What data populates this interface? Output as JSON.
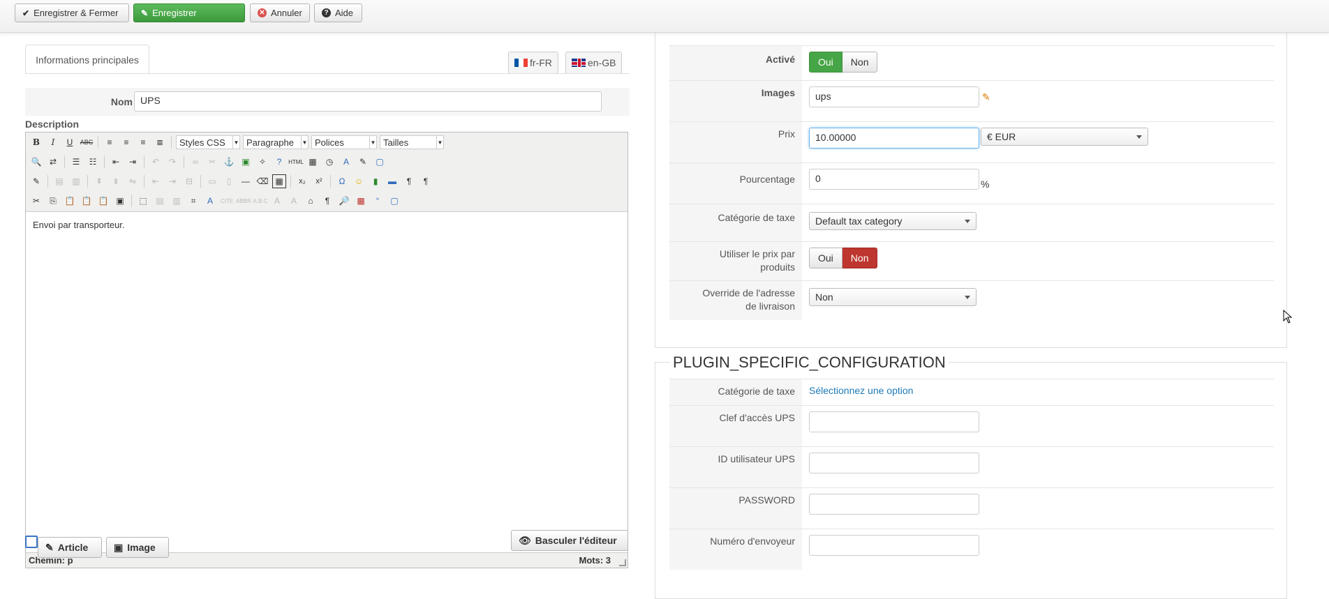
{
  "toolbar": {
    "save_close": "Enregistrer & Fermer",
    "save": "Enregistrer",
    "cancel": "Annuler",
    "help": "Aide"
  },
  "left": {
    "tab_main": "Informations principales",
    "lang_fr": "fr-FR",
    "lang_en": "en-GB",
    "nom_label": "Nom",
    "nom_value": "UPS",
    "description_label": "Description",
    "editor": {
      "styles": "Styles CSS",
      "paragraph": "Paragraphe",
      "fonts": "Polices",
      "sizes": "Tailles",
      "content": "Envoi par transporteur.",
      "path": "Chemin: p",
      "words": "Mots: 3"
    },
    "article_button": "Article",
    "image_button": "Image",
    "toggle_editor": "Basculer l'éditeur"
  },
  "right": {
    "active_label": "Activé",
    "active_yes": "Oui",
    "active_no": "Non",
    "images_label": "Images",
    "images_value": "ups",
    "price_label": "Prix",
    "price_value": "10.00000",
    "currency": "€ EUR",
    "percent_label": "Pourcentage",
    "percent_value": "0",
    "percent_sign": "%",
    "tax_cat_label": "Catégorie de taxe",
    "tax_cat_value": "Default tax category",
    "per_product_label_1": "Utiliser le prix par",
    "per_product_label_2": "produits",
    "per_product_yes": "Oui",
    "per_product_no": "Non",
    "override_label_1": "Override de l'adresse",
    "override_label_2": "de livraison",
    "override_value": "Non",
    "plugin_legend": "PLUGIN_SPECIFIC_CONFIGURATION",
    "plugin_tax_label": "Catégorie de taxe",
    "plugin_tax_link": "Sélectionnez une option",
    "ups_key_label": "Clef d'accès UPS",
    "ups_user_label": "ID utilisateur UPS",
    "password_label": "PASSWORD",
    "sender_label": "Numéro d'envoyeur"
  },
  "colors": {
    "green": "#46a546",
    "red": "#bd362f",
    "link": "#1f7bb6"
  }
}
